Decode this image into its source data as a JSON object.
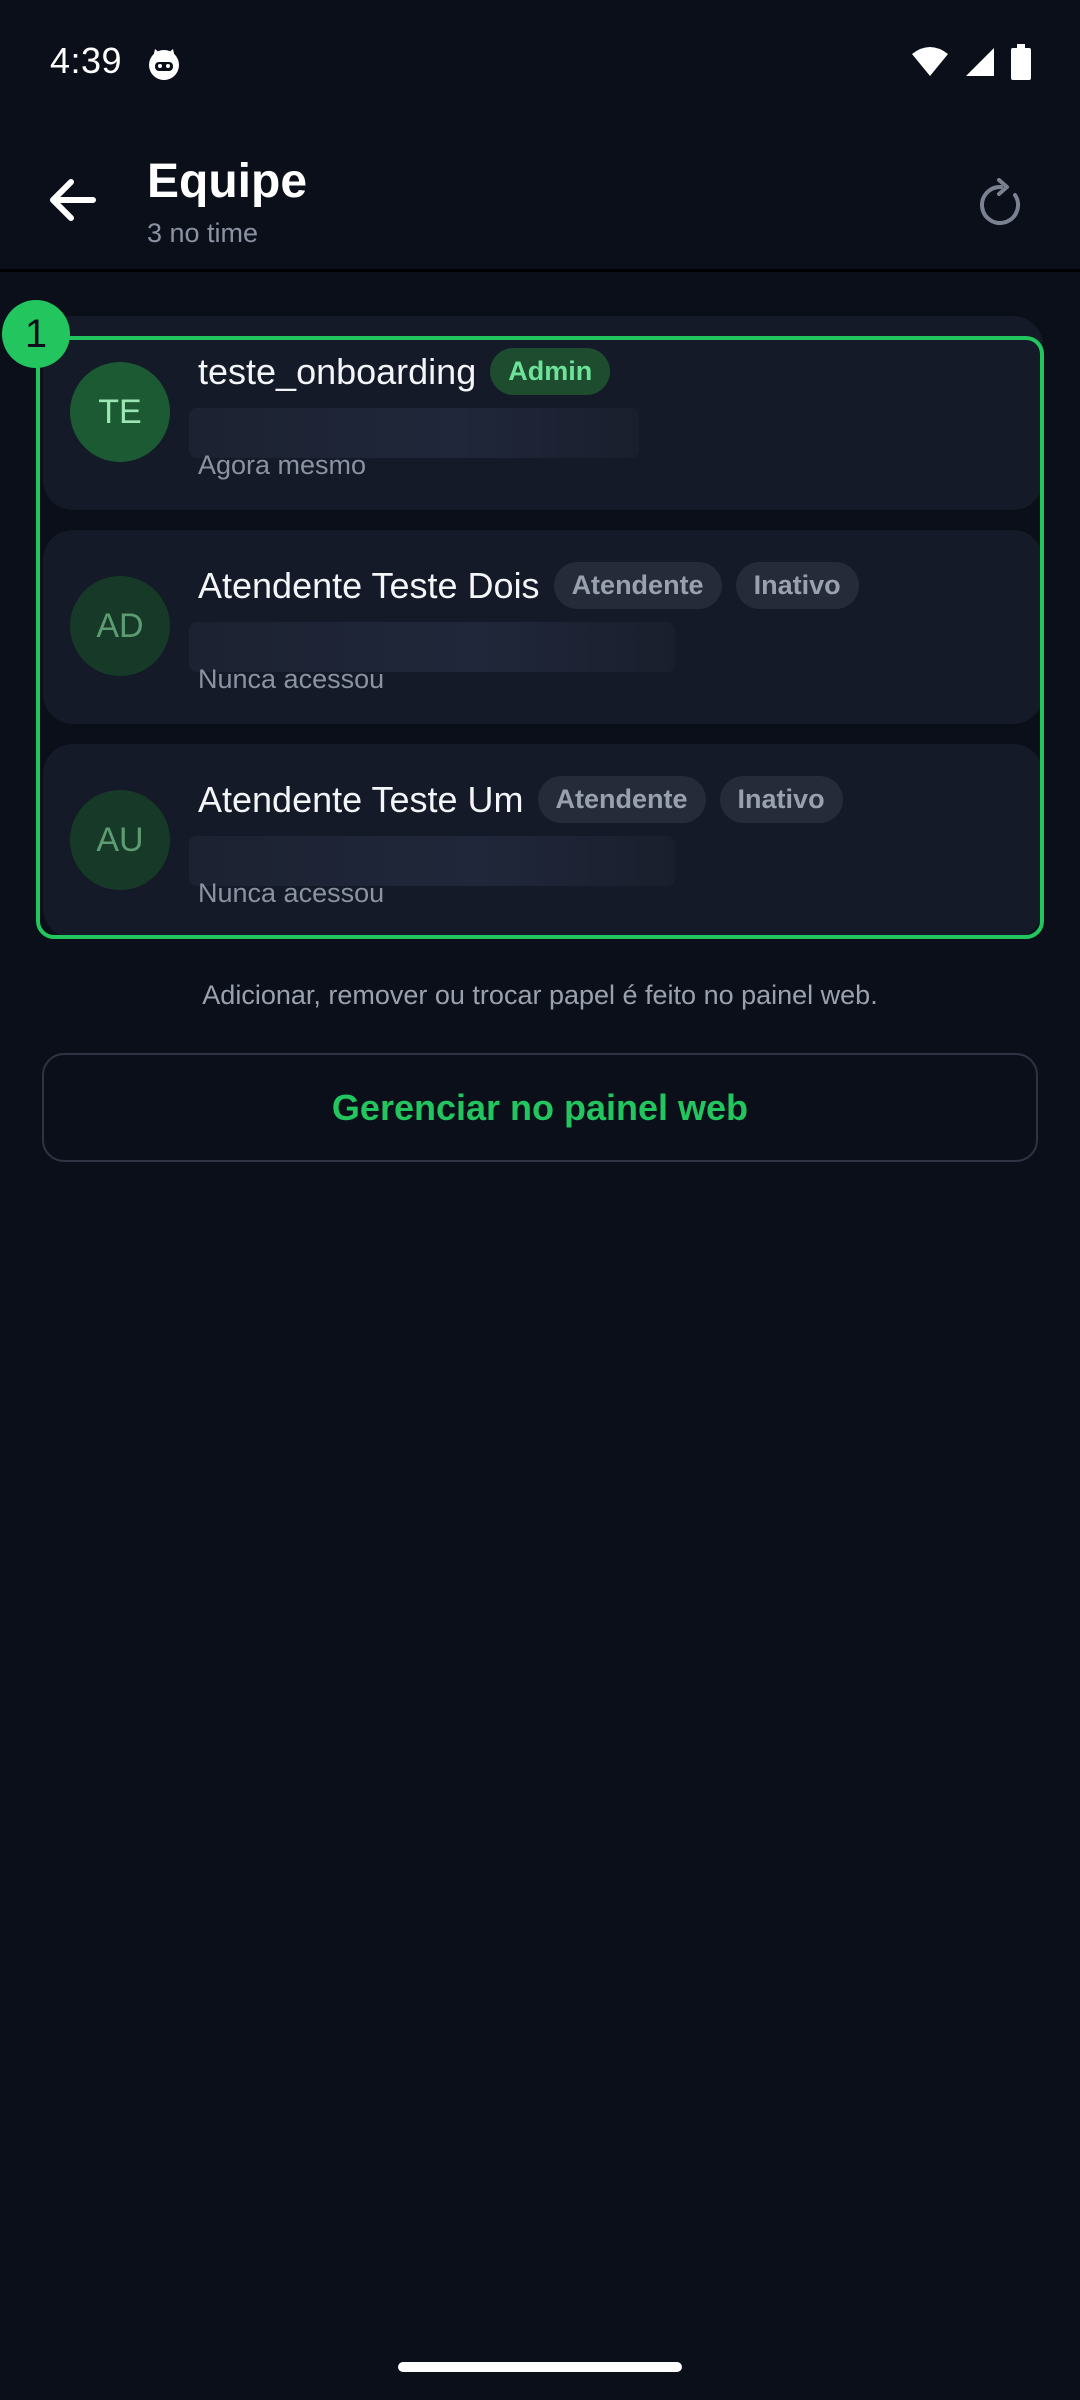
{
  "status_bar": {
    "time": "4:39",
    "icons": [
      "cat-notification-icon",
      "wifi-icon",
      "signal-icon",
      "battery-icon"
    ]
  },
  "header": {
    "title": "Equipe",
    "subtitle": "3 no time",
    "back_icon": "arrow-left-icon",
    "refresh_icon": "refresh-icon"
  },
  "selection_marker": "1",
  "members": [
    {
      "initials": "TE",
      "name": "teste_onboarding",
      "badges": [
        "Admin"
      ],
      "last_seen": "Agora mesmo",
      "active": true
    },
    {
      "initials": "AD",
      "name": "Atendente Teste Dois",
      "badges": [
        "Atendente",
        "Inativo"
      ],
      "last_seen": "Nunca acessou",
      "active": false
    },
    {
      "initials": "AU",
      "name": "Atendente Teste Um",
      "badges": [
        "Atendente",
        "Inativo"
      ],
      "last_seen": "Nunca acessou",
      "active": false
    }
  ],
  "note": "Adicionar, remover ou trocar papel é feito no painel web.",
  "manage_button": "Gerenciar no painel web",
  "colors": {
    "background": "#0b0f1a",
    "card": "#141a27",
    "accent": "#22c55e",
    "muted_text": "#8b93a3"
  }
}
